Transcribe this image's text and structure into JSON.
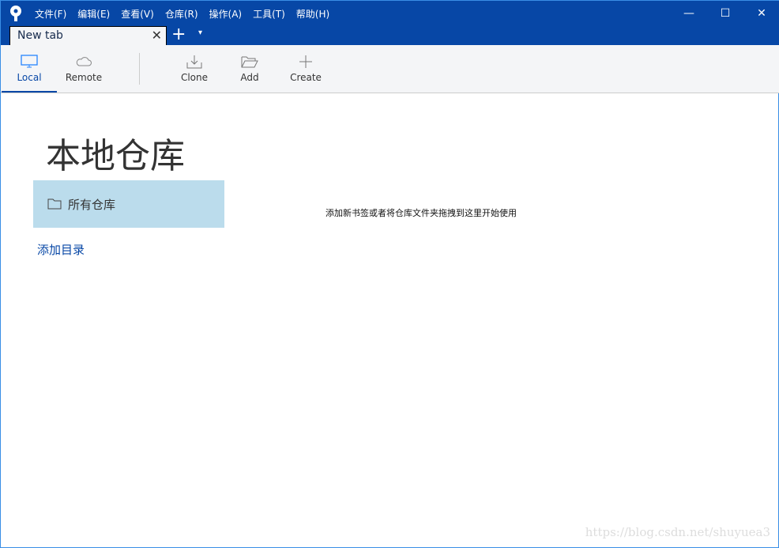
{
  "menu": [
    "文件(F)",
    "编辑(E)",
    "查看(V)",
    "仓库(R)",
    "操作(A)",
    "工具(T)",
    "帮助(H)"
  ],
  "window": {
    "minimize": "—",
    "maximize": "☐",
    "close": "✕"
  },
  "tab": {
    "label": "New tab",
    "close": "✕",
    "new": "+",
    "dropdown": "▾"
  },
  "toolbar": {
    "local": "Local",
    "remote": "Remote",
    "clone": "Clone",
    "add": "Add",
    "create": "Create"
  },
  "main": {
    "title": "本地仓库",
    "all_repos": "所有仓库",
    "add_dir": "添加目录",
    "hint": "添加新书签或者将仓库文件夹拖拽到这里开始使用"
  },
  "watermark": "https://blog.csdn.net/shuyuea3"
}
